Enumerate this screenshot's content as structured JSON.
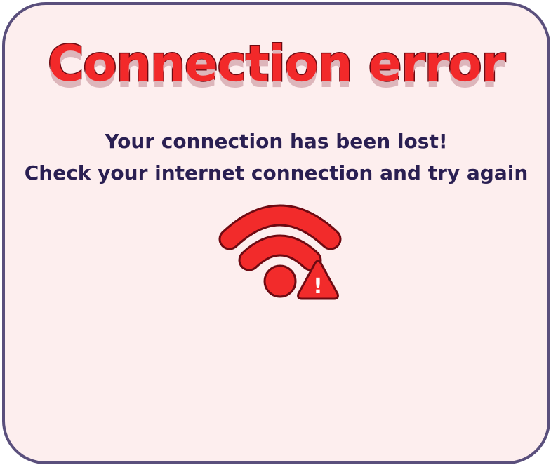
{
  "dialog": {
    "title": "Connection error",
    "message_line1": "Your connection has been lost!",
    "message_line2": "Check your internet connection and try again",
    "icon": "wifi-error-icon",
    "alert_glyph": "!"
  },
  "colors": {
    "background": "#fdeeee",
    "border": "#5a4f7c",
    "title_fill": "#f2292a",
    "title_outline": "#6e0a12",
    "text": "#2a1f52",
    "icon_fill": "#f22b2b",
    "icon_outline": "#6e0a12"
  }
}
